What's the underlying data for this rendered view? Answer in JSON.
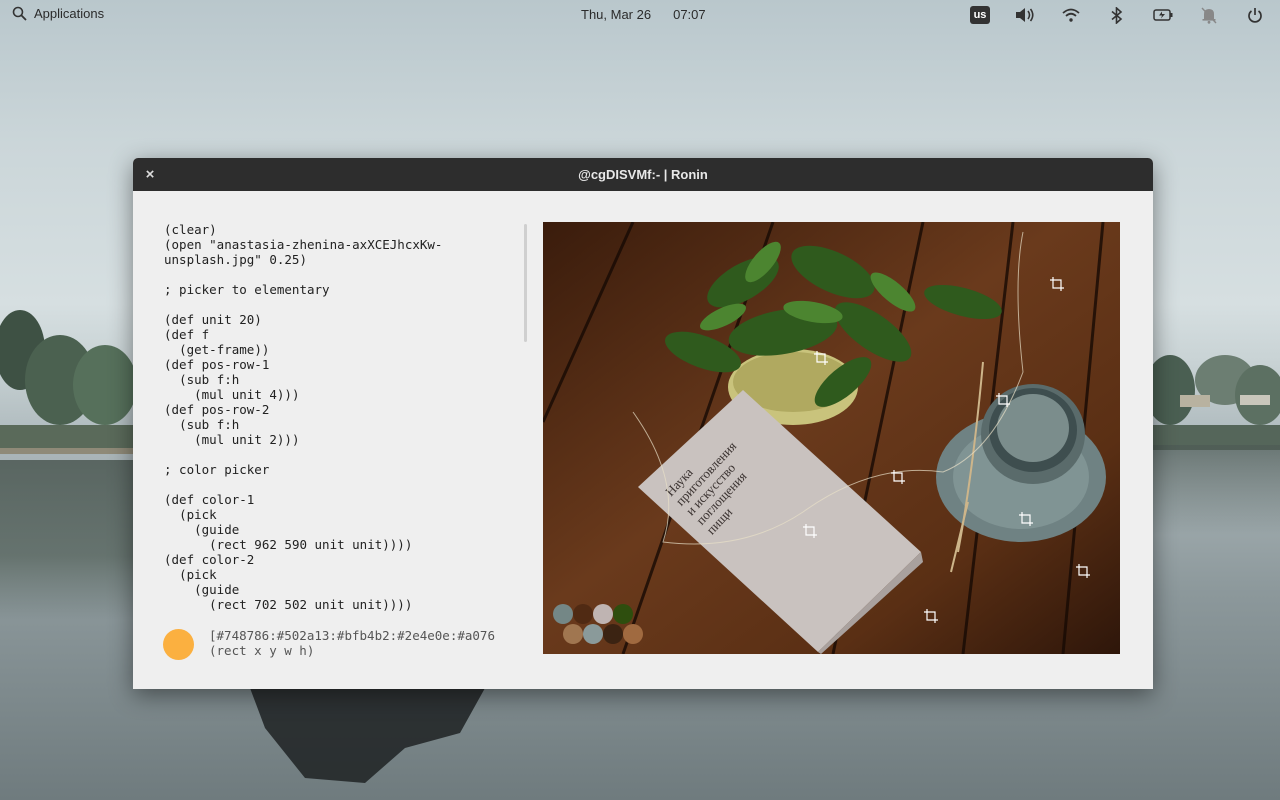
{
  "panel": {
    "applications_label": "Applications",
    "date": "Thu, Mar 26",
    "time": "07:07",
    "keyboard_layout": "us",
    "indicators": [
      "volume-icon",
      "wifi-icon",
      "bluetooth-icon",
      "battery-icon",
      "notifications-off-icon",
      "power-icon"
    ]
  },
  "window": {
    "title": "@cgDISVMf:- | Ronin",
    "close_glyph": "×"
  },
  "editor": {
    "code": "(clear)\n(open \"anastasia-zhenina-axXCEJhcxKw-\nunsplash.jpg\" 0.25)\n\n; picker to elementary\n\n(def unit 20)\n(def f\n  (get-frame))\n(def pos-row-1\n  (sub f:h\n    (mul unit 4)))\n(def pos-row-2\n  (sub f:h\n    (mul unit 2)))\n\n; color picker\n\n(def color-1\n  (pick\n    (guide\n      (rect 962 590 unit unit))))\n(def color-2\n  (pick\n    (guide\n      (rect 702 502 unit unit))))"
  },
  "status": {
    "swatch_color": "#fbb040",
    "line1": "[#748786:#502a13:#bfb4b2:#2e4e0e:#a076",
    "line2": "(rect x y w h)"
  },
  "canvas": {
    "book_text": [
      "Наука",
      "приготовления",
      "и искусство",
      "поглощения",
      "пищи"
    ],
    "palette": [
      "#748786",
      "#502a13",
      "#bfb4b2",
      "#2e4e0e",
      "#a07650",
      "#8a9a9a",
      "#3b2312",
      "#a06a40"
    ]
  },
  "colors": {
    "panel_text": "#2b2b2b",
    "titlebar": "#2d2d2d",
    "window_bg": "#efefef",
    "accent_swatch": "#fbb040"
  }
}
